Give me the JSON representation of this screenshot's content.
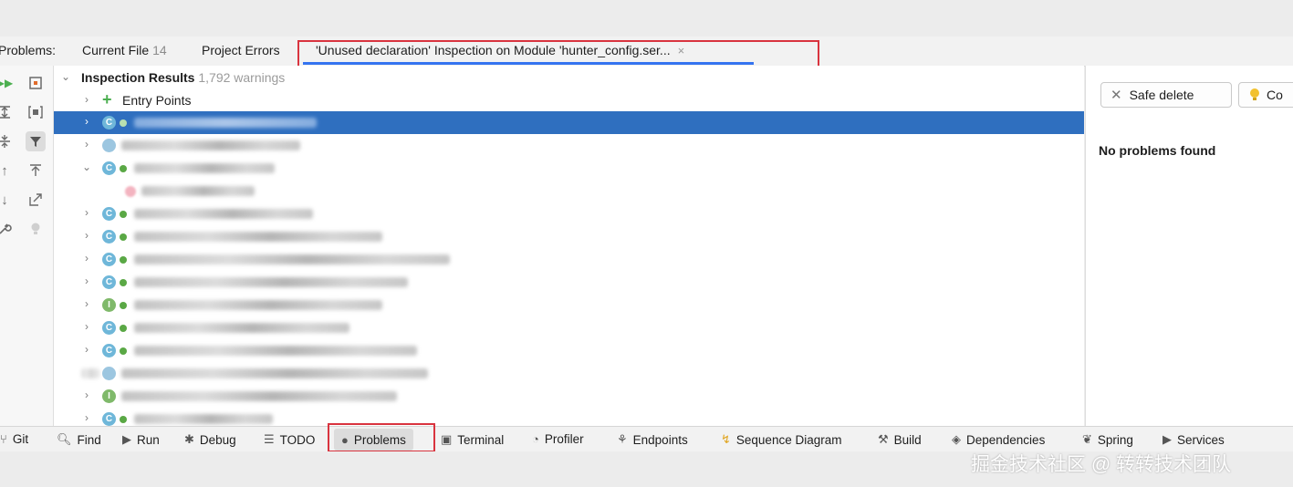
{
  "tabs": {
    "problems_label": "Problems:",
    "current_file": {
      "label": "Current File",
      "count": "14"
    },
    "project_errors": {
      "label": "Project Errors"
    },
    "inspection_tab": {
      "label": "'Unused declaration' Inspection on Module 'hunter_config.ser...",
      "close": "×"
    }
  },
  "toolbar_icons": [
    "run-icon",
    "export-icon",
    "expand-all-icon",
    "group-icon",
    "collapse-all-icon",
    "filter-icon",
    "up-icon",
    "pin-icon",
    "down-icon",
    "open-icon",
    "settings-icon",
    "bulb-icon"
  ],
  "tree": {
    "header": {
      "title": "Inspection Results",
      "count": "1,792 warnings"
    },
    "entry_points": "Entry Points",
    "blurred_rows": 14
  },
  "right_panel": {
    "safe_delete": "Safe delete",
    "second_button": "Co",
    "message": "No problems found"
  },
  "bottom_bar": {
    "items": [
      {
        "label": "Git",
        "icon": "git-icon"
      },
      {
        "label": "Find",
        "icon": "search-icon"
      },
      {
        "label": "Run",
        "icon": "run-icon"
      },
      {
        "label": "Debug",
        "icon": "bug-icon"
      },
      {
        "label": "TODO",
        "icon": "list-icon"
      },
      {
        "label": "Problems",
        "icon": "problems-icon"
      },
      {
        "label": "Terminal",
        "icon": "terminal-icon"
      },
      {
        "label": "Profiler",
        "icon": "profiler-icon"
      },
      {
        "label": "Endpoints",
        "icon": "endpoints-icon"
      },
      {
        "label": "Sequence Diagram",
        "icon": "sequence-icon"
      },
      {
        "label": "Build",
        "icon": "hammer-icon"
      },
      {
        "label": "Dependencies",
        "icon": "layers-icon"
      },
      {
        "label": "Spring",
        "icon": "leaf-icon"
      },
      {
        "label": "Services",
        "icon": "services-icon"
      }
    ]
  },
  "watermark": "掘金技术社区 @ 转转技术团队",
  "colors": {
    "accent": "#3574f0",
    "selection": "#2f6fbf",
    "highlight_box": "#d9343f"
  }
}
